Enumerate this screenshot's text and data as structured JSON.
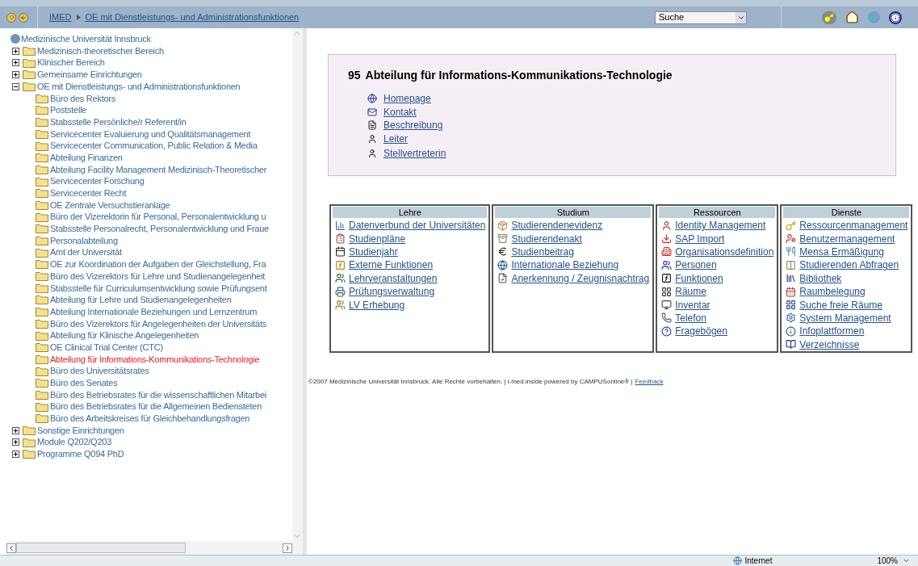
{
  "breadcrumb": [
    {
      "label": "IMED"
    },
    {
      "label": "OE mit Dienstleistungs- und Administrationsfunktionen"
    }
  ],
  "search": {
    "value": "Suche"
  },
  "tree": {
    "root": "Medizinische Universität Innsbruck",
    "items": [
      {
        "label": "Medizinisch-theoretischer Bereich",
        "expanded": false
      },
      {
        "label": "Klinischer Bereich",
        "expanded": false
      },
      {
        "label": "Gemeinsame Einrichtungen",
        "expanded": false
      },
      {
        "label": "OE mit Dienstleistungs- und Administrationsfunktionen",
        "expanded": true,
        "children": [
          {
            "label": "Büro des Rektors",
            "selected": false
          },
          {
            "label": "Poststelle",
            "selected": false
          },
          {
            "label": "Stabsstelle Persönliche/r Referent/in",
            "selected": false
          },
          {
            "label": "Servicecenter Evaluierung und Qualitätsmanagement",
            "selected": false
          },
          {
            "label": "Servicecenter Communication, Public Relation & Media",
            "selected": false
          },
          {
            "label": "Abteilung Finanzen",
            "selected": false
          },
          {
            "label": "Abteilung Facility Management Medizinisch-Theoretischer",
            "selected": false
          },
          {
            "label": "Servicecenter Forschung",
            "selected": false
          },
          {
            "label": "Servicecenter Recht",
            "selected": false
          },
          {
            "label": "OE Zentrale Versuchstieranlage",
            "selected": false
          },
          {
            "label": "Büro der Vizerektorin für Personal, Personalentwicklung u",
            "selected": false
          },
          {
            "label": "Stabsstelle Personalrecht, Personalentwicklung und Fraue",
            "selected": false
          },
          {
            "label": "Personalabteilung",
            "selected": false
          },
          {
            "label": "Amt der Universität",
            "selected": false
          },
          {
            "label": "OE zur Koordination der Aufgaben der Gleichstellung, Fra",
            "selected": false
          },
          {
            "label": "Büro des Vizerektors für Lehre und Studienangelegenheit",
            "selected": false
          },
          {
            "label": "Stabsstelle für Curriculumsentwicklung sowie Prüfungsent",
            "selected": false
          },
          {
            "label": "Abteilung für Lehre und Studienangelegenheiten",
            "selected": false
          },
          {
            "label": "Abteilung Internationale Beziehungen und Lernzentrum",
            "selected": false
          },
          {
            "label": "Büro des Vizerektors für Angelegenheiten der Universitäts",
            "selected": false
          },
          {
            "label": "Abteilung für Klinische Angelegenheiten",
            "selected": false
          },
          {
            "label": "OE Clinical Trial Center (CTC)",
            "selected": false
          },
          {
            "label": "Abteilung für Informations-Kommunikations-Technologie",
            "selected": true
          },
          {
            "label": "Büro des Universitätsrates",
            "selected": false
          },
          {
            "label": "Büro des Senates",
            "selected": false
          },
          {
            "label": "Büro des Betriebsrates für die wissenschaftlichen Mitarbei",
            "selected": false
          },
          {
            "label": "Büro des Betriebsrates für die Allgemeinen Bediensteten",
            "selected": false
          },
          {
            "label": "Büro des Arbeitskreises für Gleichbehandlungsfragen",
            "selected": false
          }
        ]
      },
      {
        "label": "Sonstige Einrichtungen",
        "expanded": false
      },
      {
        "label": "Module Q202/Q203",
        "expanded": false
      },
      {
        "label": "Programme Q094 PhD",
        "expanded": false
      }
    ]
  },
  "info": {
    "number": "95",
    "title": "Abteilung für Informations-Kommunikations-Technologie",
    "links": [
      "Homepage",
      "Kontakt",
      "Beschreibung",
      "Leiter",
      "Stellvertreterin"
    ]
  },
  "panels": [
    {
      "title": "Lehre",
      "links": [
        "Datenverbund der Universitäten",
        "Studienpläne",
        "Studienjahr",
        "Externe Funktionen",
        "Lehrveranstaltungen",
        "Prüfungsverwaltung",
        "LV Erhebung"
      ]
    },
    {
      "title": "Studium",
      "links": [
        "Studierendenevidenz",
        "Studierendenakt",
        "Studienbeitrag",
        "Internationale Beziehung",
        "Anerkennung / Zeugnisnachtrag"
      ]
    },
    {
      "title": "Ressourcen",
      "links": [
        "Identity Management",
        "SAP Import",
        "Organisationsdefinition",
        "Personen",
        "Funktionen",
        "Räume",
        "Inventar",
        "Telefon",
        "Fragebögen"
      ]
    },
    {
      "title": "Dienste",
      "links": [
        "Ressourcenmanagement",
        "Benutzermanagement",
        "Mensa Ermäßigung",
        "Studierenden Abfragen",
        "Bibliothek",
        "Raumbelegung",
        "Suche freie Räume",
        "System Management",
        "Infoplattformen",
        "Verzeichnisse"
      ]
    }
  ],
  "footer": {
    "text": "©2007 Medizinische Universität Innsbruck. Alle Rechte vorbehalten. | i-med.inside powered by CAMPUSonline® |",
    "link": "Feedback"
  },
  "status_bar": {
    "zone": "Internet",
    "zoom": "100%"
  }
}
